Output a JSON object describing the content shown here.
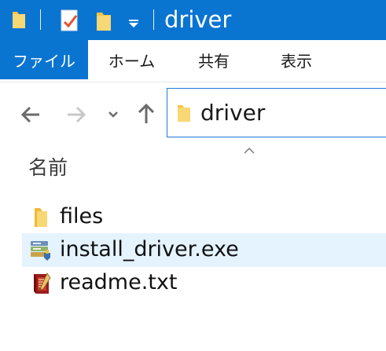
{
  "window": {
    "title": "driver"
  },
  "quick_access": {
    "icons": [
      "folder-icon",
      "properties-icon",
      "new-folder-icon",
      "customize-dropdown-icon"
    ]
  },
  "ribbon": {
    "tabs": [
      {
        "label": "ファイル",
        "active": true
      },
      {
        "label": "ホーム",
        "active": false
      },
      {
        "label": "共有",
        "active": false
      },
      {
        "label": "表示",
        "active": false
      }
    ]
  },
  "navigation": {
    "back_icon": "arrow-left-icon",
    "forward_icon": "arrow-right-icon",
    "recent_icon": "chevron-down-icon",
    "up_icon": "arrow-up-icon"
  },
  "address_bar": {
    "path": "driver",
    "icon": "folder-icon"
  },
  "file_list": {
    "column_header": "名前",
    "sort_indicator": "caret-up-icon",
    "items": [
      {
        "name": "files",
        "icon": "folder-icon",
        "selected": false
      },
      {
        "name": "install_driver.exe",
        "icon": "installer-icon",
        "selected": true
      },
      {
        "name": "readme.txt",
        "icon": "text-book-icon",
        "selected": false
      }
    ]
  },
  "colors": {
    "titlebar": "#0a74d1",
    "selection": "#e5f3ff",
    "folder": "#f5c443"
  }
}
